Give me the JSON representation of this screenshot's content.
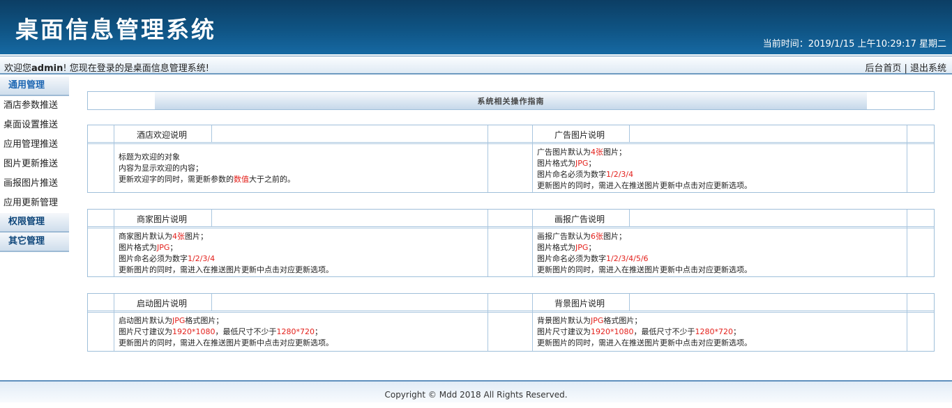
{
  "header": {
    "app_title": "桌面信息管理系统",
    "clock": "当前时间：2019/1/15 上午10:29:17 星期二"
  },
  "welcome": {
    "prefix": "欢迎您",
    "user": "admin",
    "suffix": "! 您现在登录的是桌面信息管理系统!",
    "home_link": "后台首页",
    "separator": " | ",
    "logout_link": "退出系统"
  },
  "sidebar": {
    "groups": [
      "通用管理",
      "权限管理",
      "其它管理"
    ],
    "items": [
      "酒店参数推送",
      "桌面设置推送",
      "应用管理推送",
      "图片更新推送",
      "画报图片推送",
      "应用更新管理"
    ]
  },
  "guide_title": "系统相关操作指南",
  "panels": [
    {
      "left": {
        "title": "酒店欢迎说明",
        "lines": [
          [
            {
              "t": "标题为欢迎的对象"
            }
          ],
          [
            {
              "t": "内容为显示欢迎的内容；"
            }
          ],
          [
            {
              "t": "更新欢迎字的同时，需更新参数的"
            },
            {
              "t": "数值",
              "red": true
            },
            {
              "t": "大于之前的。"
            }
          ]
        ]
      },
      "right": {
        "title": "广告图片说明",
        "lines": [
          [
            {
              "t": "广告图片默认为"
            },
            {
              "t": "4张",
              "red": true
            },
            {
              "t": "图片；"
            }
          ],
          [
            {
              "t": "图片格式为"
            },
            {
              "t": "JPG",
              "red": true
            },
            {
              "t": "；"
            }
          ],
          [
            {
              "t": "图片命名必须为数字"
            },
            {
              "t": "1/2/3/4",
              "red": true
            }
          ],
          [
            {
              "t": "更新图片的同时，需进入在推送图片更新中点击对应更新选项。"
            }
          ]
        ]
      }
    },
    {
      "left": {
        "title": "商家图片说明",
        "lines": [
          [
            {
              "t": "商家图片默认为"
            },
            {
              "t": "4张",
              "red": true
            },
            {
              "t": "图片；"
            }
          ],
          [
            {
              "t": "图片格式为"
            },
            {
              "t": "JPG",
              "red": true
            },
            {
              "t": "；"
            }
          ],
          [
            {
              "t": "图片命名必须为数字"
            },
            {
              "t": "1/2/3/4",
              "red": true
            }
          ],
          [
            {
              "t": "更新图片的同时，需进入在推送图片更新中点击对应更新选项。"
            }
          ]
        ]
      },
      "right": {
        "title": "画报广告说明",
        "lines": [
          [
            {
              "t": "画报广告默认为"
            },
            {
              "t": "6张",
              "red": true
            },
            {
              "t": "图片；"
            }
          ],
          [
            {
              "t": "图片格式为"
            },
            {
              "t": "JPG",
              "red": true
            },
            {
              "t": "；"
            }
          ],
          [
            {
              "t": "图片命名必须为数字"
            },
            {
              "t": "1/2/3/4/5/6",
              "red": true
            }
          ],
          [
            {
              "t": "更新图片的同时，需进入在推送图片更新中点击对应更新选项。"
            }
          ]
        ]
      }
    },
    {
      "left": {
        "title": "启动图片说明",
        "lines": [
          [
            {
              "t": "启动图片默认为"
            },
            {
              "t": "JPG",
              "red": true
            },
            {
              "t": "格式图片；"
            }
          ],
          [
            {
              "t": "图片尺寸建议为"
            },
            {
              "t": "1920*1080",
              "red": true
            },
            {
              "t": "，最低尺寸不少于"
            },
            {
              "t": "1280*720",
              "red": true
            },
            {
              "t": "；"
            }
          ],
          [
            {
              "t": "更新图片的同时，需进入在推送图片更新中点击对应更新选项。"
            }
          ]
        ]
      },
      "right": {
        "title": "背景图片说明",
        "lines": [
          [
            {
              "t": "背景图片默认为"
            },
            {
              "t": "JPG",
              "red": true
            },
            {
              "t": "格式图片；"
            }
          ],
          [
            {
              "t": "图片尺寸建议为"
            },
            {
              "t": "1920*1080",
              "red": true
            },
            {
              "t": "，最低尺寸不少于"
            },
            {
              "t": "1280*720",
              "red": true
            },
            {
              "t": "；"
            }
          ],
          [
            {
              "t": "更新图片的同时，需进入在推送图片更新中点击对应更新选项。"
            }
          ]
        ]
      }
    }
  ],
  "footer": "Copyright © Mdd 2018 All Rights Reserved.",
  "colors": {
    "header_dark": "#0c3e64",
    "accent_red": "#e3201b",
    "border": "#9fbfda"
  }
}
